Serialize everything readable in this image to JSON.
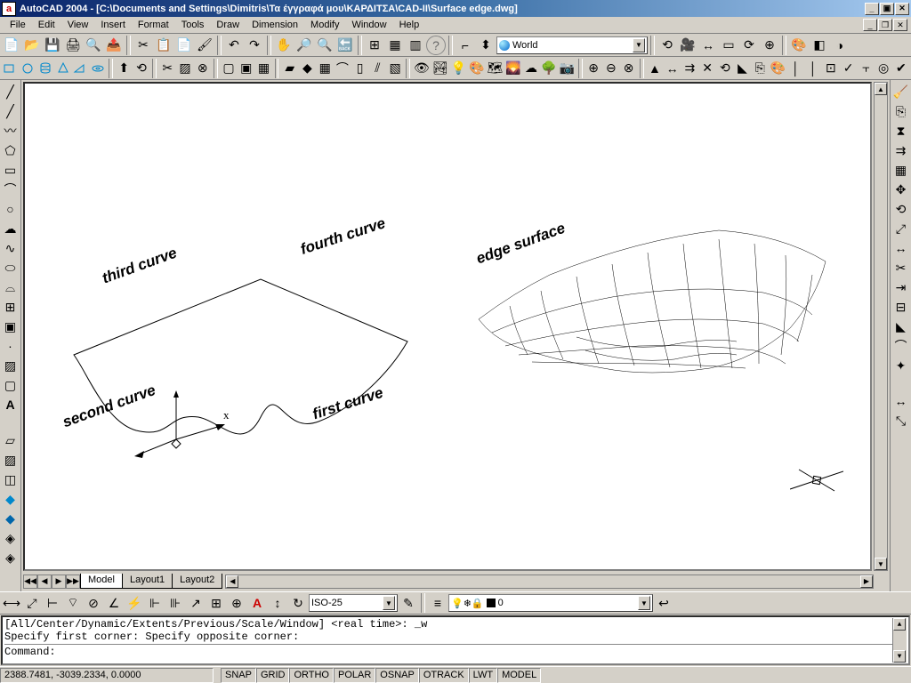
{
  "title": "AutoCAD 2004 - [C:\\Documents and Settings\\Dimitris\\Τα έγγραφά μου\\ΚΑΡΔΙΤΣΑ\\CAD-II\\Surface edge.dwg]",
  "menu": [
    "File",
    "Edit",
    "View",
    "Insert",
    "Format",
    "Tools",
    "Draw",
    "Dimension",
    "Modify",
    "Window",
    "Help"
  ],
  "ucs_combo": "World",
  "dim_style_combo": "ISO-25",
  "layer_combo": "0",
  "tabs": {
    "active": "Model",
    "items": [
      "Model",
      "Layout1",
      "Layout2"
    ]
  },
  "command_history": [
    "[All/Center/Dynamic/Extents/Previous/Scale/Window] <real time>: _w",
    "Specify first corner: Specify opposite corner:"
  ],
  "command_prompt": "Command:",
  "status": {
    "coords": "2388.7481, -3039.2334, 0.0000",
    "toggles": [
      "SNAP",
      "GRID",
      "ORTHO",
      "POLAR",
      "OSNAP",
      "OTRACK",
      "LWT",
      "MODEL"
    ]
  },
  "drawing_labels": {
    "third_curve": "third curve",
    "fourth_curve": "fourth curve",
    "second_curve": "second curve",
    "first_curve": "first curve",
    "edge_surface": "edge surface",
    "axis_x": "x"
  }
}
